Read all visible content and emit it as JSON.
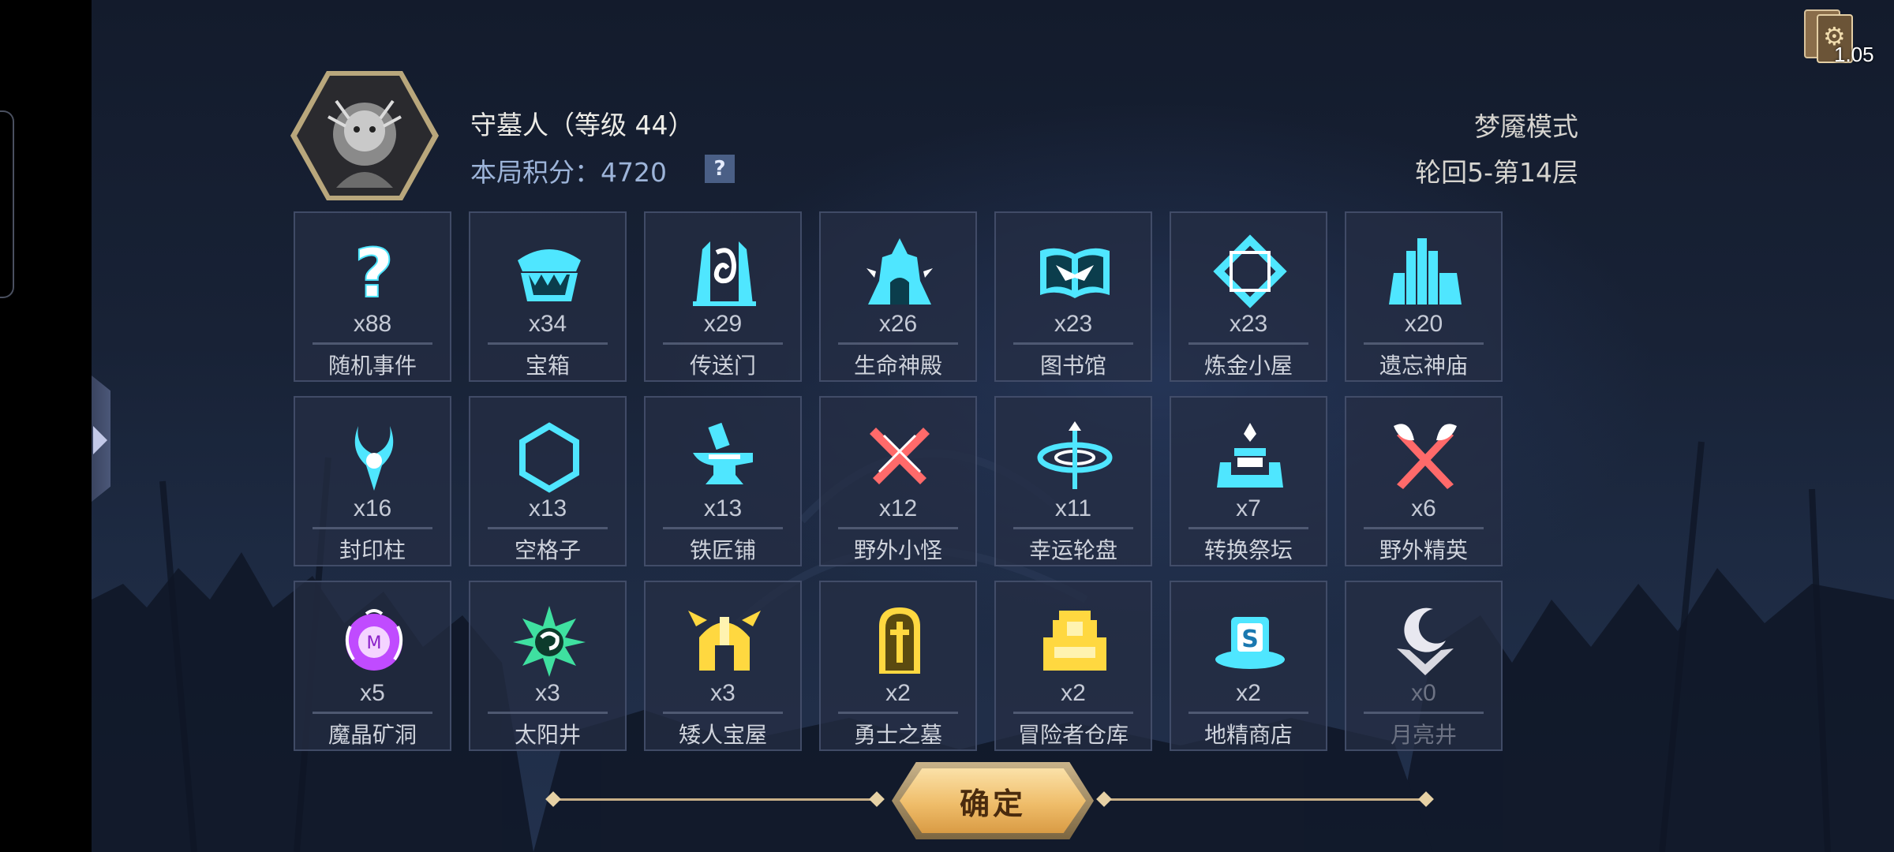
{
  "deck": {
    "label": "1.05"
  },
  "player": {
    "name": "守墓人（等级 44）",
    "score_label": "本局积分：",
    "score_value": "4720",
    "help": "?"
  },
  "mode": {
    "name": "梦魇模式",
    "floor": "轮回5-第14层"
  },
  "tiles": [
    {
      "label": "随机事件",
      "count": "x88",
      "icon": "question-icon",
      "color": "#4fe6ff"
    },
    {
      "label": "宝箱",
      "count": "x34",
      "icon": "chest-icon",
      "color": "#4fe6ff"
    },
    {
      "label": "传送门",
      "count": "x29",
      "icon": "portal-icon",
      "color": "#4fe6ff"
    },
    {
      "label": "生命神殿",
      "count": "x26",
      "icon": "temple-icon",
      "color": "#4fe6ff"
    },
    {
      "label": "图书馆",
      "count": "x23",
      "icon": "book-icon",
      "color": "#4fe6ff"
    },
    {
      "label": "炼金小屋",
      "count": "x23",
      "icon": "alchemy-icon",
      "color": "#4fe6ff"
    },
    {
      "label": "遗忘神庙",
      "count": "x20",
      "icon": "shrine-icon",
      "color": "#4fe6ff"
    },
    {
      "label": "封印柱",
      "count": "x16",
      "icon": "seal-pillar-icon",
      "color": "#4fe6ff"
    },
    {
      "label": "空格子",
      "count": "x13",
      "icon": "hexagon-icon",
      "color": "#4fe6ff"
    },
    {
      "label": "铁匠铺",
      "count": "x13",
      "icon": "anvil-icon",
      "color": "#4fe6ff"
    },
    {
      "label": "野外小怪",
      "count": "x12",
      "icon": "crossed-swords-icon",
      "color": "#ff6a6a"
    },
    {
      "label": "幸运轮盘",
      "count": "x11",
      "icon": "wheel-icon",
      "color": "#4fe6ff"
    },
    {
      "label": "转换祭坛",
      "count": "x7",
      "icon": "altar-icon",
      "color": "#4fe6ff"
    },
    {
      "label": "野外精英",
      "count": "x6",
      "icon": "crossed-axes-icon",
      "color": "#ff6a6a"
    },
    {
      "label": "魔晶矿洞",
      "count": "x5",
      "icon": "crystal-mine-icon",
      "color": "#c04bff"
    },
    {
      "label": "太阳井",
      "count": "x3",
      "icon": "sun-well-icon",
      "color": "#3fe0a0"
    },
    {
      "label": "矮人宝屋",
      "count": "x3",
      "icon": "dwarf-helmet-icon",
      "color": "#ffd840"
    },
    {
      "label": "勇士之墓",
      "count": "x2",
      "icon": "tomb-icon",
      "color": "#ffd840"
    },
    {
      "label": "冒险者仓库",
      "count": "x2",
      "icon": "warehouse-icon",
      "color": "#ffd840"
    },
    {
      "label": "地精商店",
      "count": "x2",
      "icon": "goblin-shop-icon",
      "color": "#4fe6ff"
    },
    {
      "label": "月亮井",
      "count": "x0",
      "icon": "moon-well-icon",
      "color": "#e8e8f0"
    }
  ],
  "confirm": {
    "label": "确定"
  }
}
